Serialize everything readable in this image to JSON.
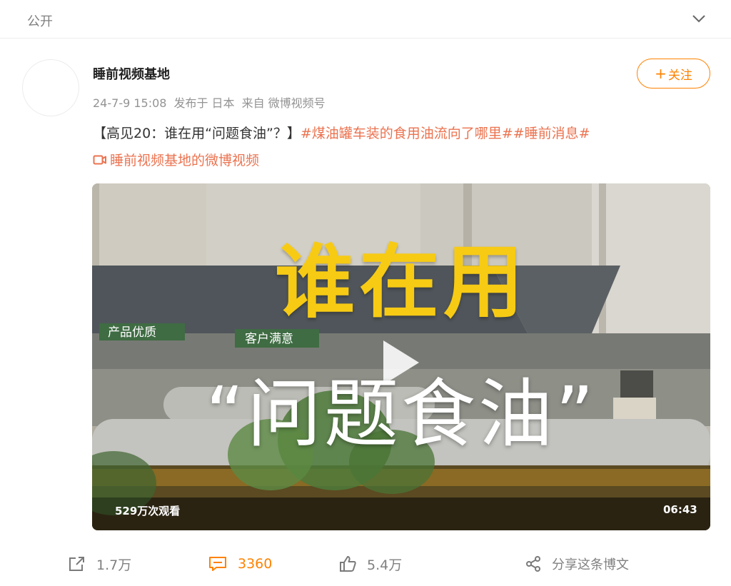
{
  "header": {
    "visibility_label": "公开",
    "chevron_icon": "chevron-down-icon"
  },
  "post": {
    "author": "睡前视频基地",
    "meta": {
      "date": "24-7-9 15:08",
      "published_in": "发布于 日本",
      "source": "来自 微博视频号"
    },
    "follow_label": "关注",
    "text_plain": "【高见20：谁在用“问题食油”？】",
    "hashtags": [
      "#煤油罐车装的食用油流向了哪里#",
      "#睡前消息#"
    ],
    "source_link": "睡前视频基地的微博视频",
    "source_link_icon": "video-camera-icon"
  },
  "video": {
    "title_line1": "谁在用",
    "title_line2": "“问题食油”",
    "scene_text_left": "产品优质",
    "scene_text_right": "客户满意",
    "views": "529万次观看",
    "duration": "06:43",
    "play_icon": "play-icon"
  },
  "actions": {
    "forward": {
      "icon": "forward-icon",
      "count": "1.7万"
    },
    "comment": {
      "icon": "comment-icon",
      "count": "3360"
    },
    "like": {
      "icon": "like-icon",
      "count": "5.4万"
    },
    "share": {
      "icon": "share-icon",
      "label": "分享这条博文"
    }
  },
  "colors": {
    "accent": "#ff8200",
    "tag": "#eb7350",
    "title_yellow": "#f7cb14"
  }
}
